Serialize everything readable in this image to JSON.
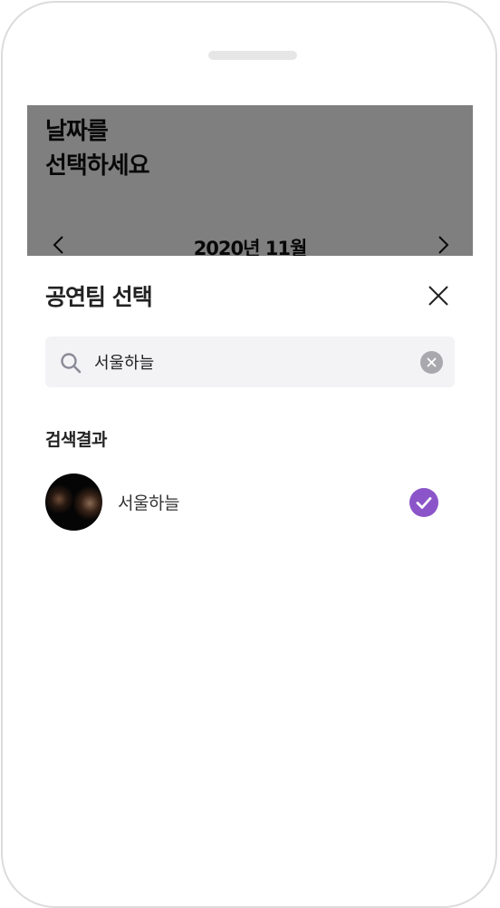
{
  "background_page": {
    "title": "날짜를\n선택하세요",
    "month_label": "2020년 11월"
  },
  "sheet": {
    "title": "공연팀 선택",
    "search": {
      "value": "서울하늘"
    },
    "section_label": "검색결과",
    "results": [
      {
        "name": "서울하늘",
        "selected": true
      }
    ]
  },
  "colors": {
    "accent": "#8b55c9",
    "search_bg": "#f3f3f6",
    "overlay": "rgba(0,0,0,0.5)"
  },
  "icons": [
    "chevron-left-icon",
    "chevron-right-icon",
    "close-icon",
    "search-icon",
    "clear-icon",
    "check-icon"
  ]
}
